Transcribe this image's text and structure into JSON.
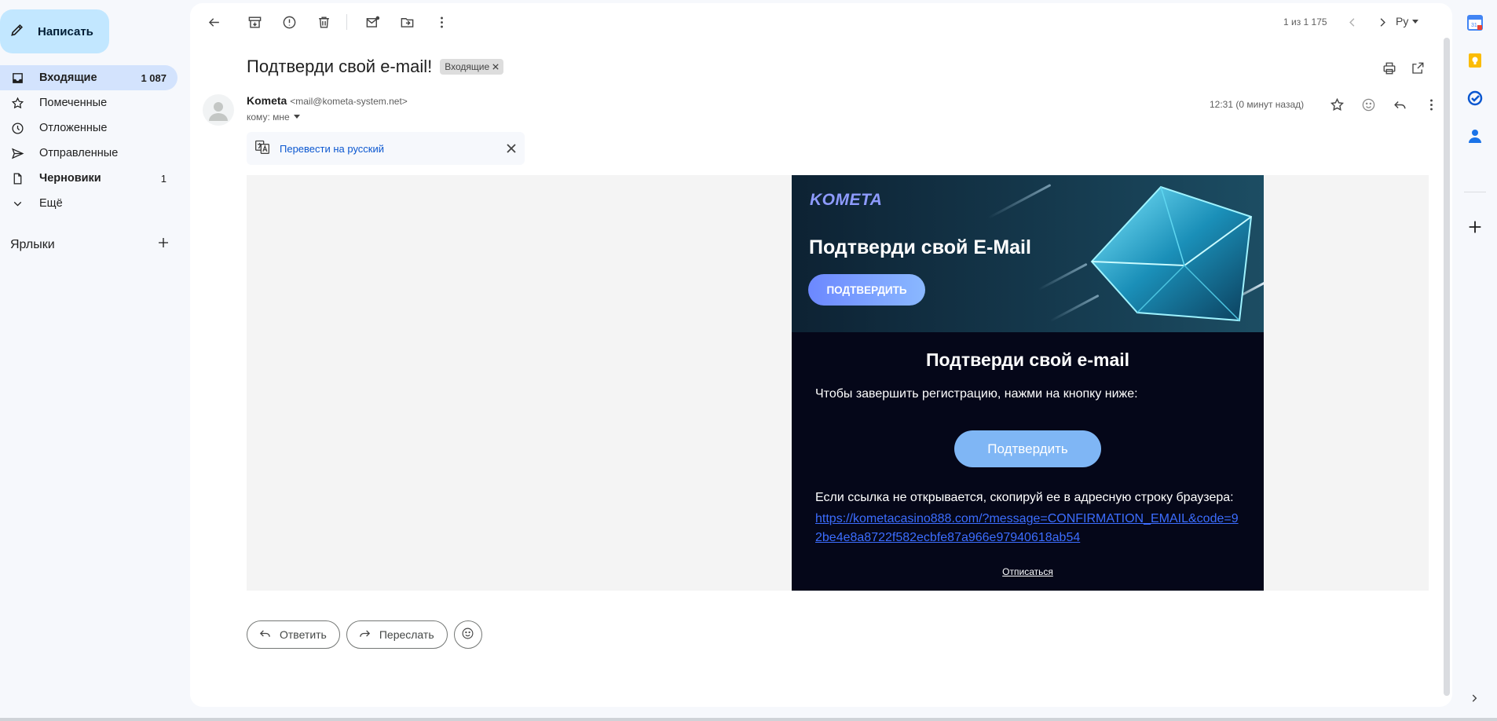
{
  "sidebar": {
    "compose_label": "Написать",
    "items": [
      {
        "label": "Входящие",
        "count": "1 087"
      },
      {
        "label": "Помеченные",
        "count": ""
      },
      {
        "label": "Отложенные",
        "count": ""
      },
      {
        "label": "Отправленные",
        "count": ""
      },
      {
        "label": "Черновики",
        "count": "1"
      },
      {
        "label": "Ещё",
        "count": ""
      }
    ],
    "labels_heading": "Ярлыки"
  },
  "toolbar": {
    "pager": "1 из 1 175",
    "language": "Ру"
  },
  "message": {
    "subject": "Подтверди свой e-mail!",
    "chip": "Входящие",
    "sender_name": "Kometa",
    "sender_email": "<mail@kometa-system.net>",
    "to": "кому: мне",
    "time": "12:31 (0 минут назад)",
    "translate_link": "Перевести на русский"
  },
  "email": {
    "logo": "KOMETA",
    "hero_title": "Подтверди свой E-Mail",
    "hero_button": "ПОДТВЕРДИТЬ",
    "title": "Подтверди свой e-mail",
    "text": "Чтобы завершить регистрацию, нажми на кнопку ниже:",
    "confirm_button": "Подтвердить",
    "fallback_text": "Если ссылка не открывается, скопируй ее в адресную строку браузера:",
    "link": "https://kometacasino888.com/?message=CONFIRMATION_EMAIL&code=92be4e8a8722f582ecbfe87a966e97940618ab54",
    "unsubscribe": "Отписаться"
  },
  "actions": {
    "reply": "Ответить",
    "forward": "Переслать"
  },
  "colors": {
    "accent": "#c2e7ff",
    "active_nav": "#d3e3fd",
    "email_bg": "#050719",
    "confirm_button": "#7fb6f5",
    "link": "#3c6dff"
  }
}
